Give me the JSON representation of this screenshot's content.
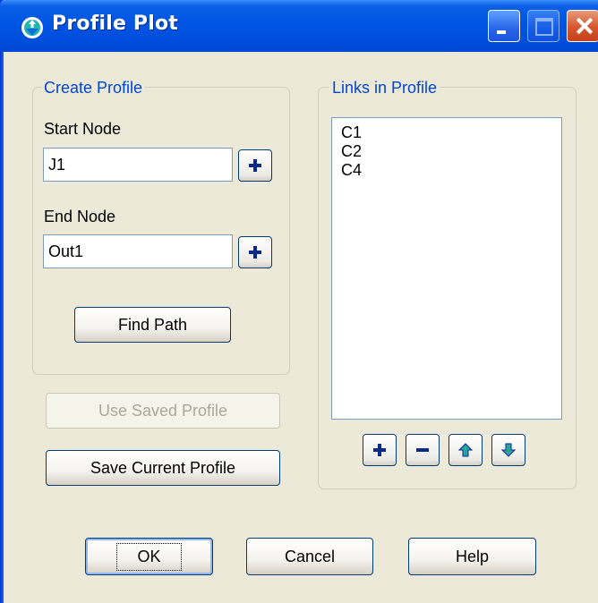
{
  "window": {
    "title": "Profile Plot"
  },
  "title_buttons": {
    "minimize": "minimize-icon",
    "maximize": "maximize-icon",
    "close": "close-icon"
  },
  "create_profile": {
    "legend": "Create Profile",
    "start_node_label": "Start Node",
    "start_node_value": "J1",
    "end_node_label": "End Node",
    "end_node_value": "Out1",
    "find_path_label": "Find Path"
  },
  "use_saved_profile_label": "Use Saved Profile",
  "save_current_profile_label": "Save Current Profile",
  "links_in_profile": {
    "legend": "Links in Profile",
    "items": [
      "C1",
      "C2",
      "C4"
    ]
  },
  "link_buttons": {
    "add": "plus-icon",
    "remove": "minus-icon",
    "move_up": "arrow-up-icon",
    "move_down": "arrow-down-icon"
  },
  "footer": {
    "ok_label": "OK",
    "cancel_label": "Cancel",
    "help_label": "Help"
  },
  "colors": {
    "title_bar": "#0054e3",
    "group_legend": "#0046d5",
    "dialog_bg": "#ece9d8",
    "arrow_icon": "#2aa39a",
    "plus_icon": "#0a2a8a"
  }
}
